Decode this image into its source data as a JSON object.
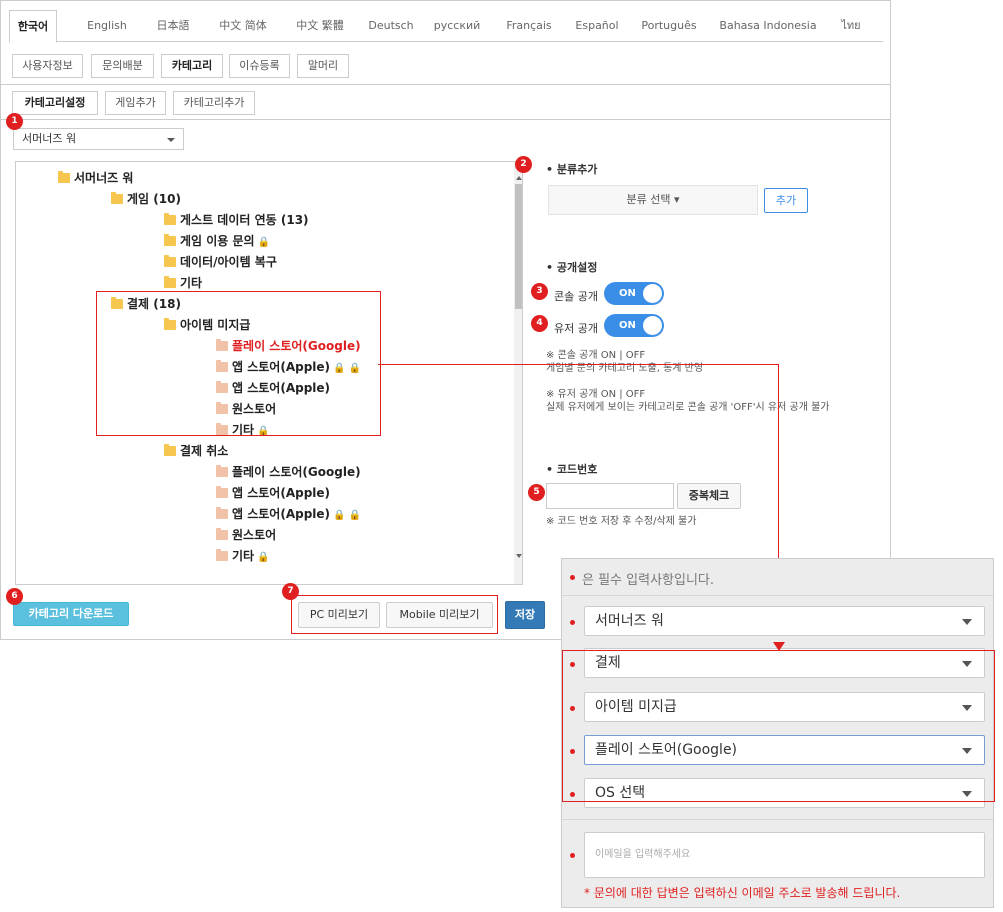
{
  "languages": [
    "한국어",
    "English",
    "日本語",
    "中文 简体",
    "中文 繁體",
    "Deutsch",
    "русский",
    "Français",
    "Español",
    "Português",
    "Bahasa Indonesia",
    "ไทย"
  ],
  "tabs": [
    "사용자정보",
    "문의배분",
    "카테고리",
    "이슈등록",
    "말머리"
  ],
  "subtabs": [
    "카테고리설정",
    "게임추가",
    "카테고리추가"
  ],
  "game_select": "서머너즈 워",
  "badges": [
    "1",
    "2",
    "3",
    "4",
    "5",
    "6",
    "7"
  ],
  "tree": [
    {
      "label": "서머너즈 워",
      "lock": ""
    },
    {
      "label": "게임 (10)",
      "lock": ""
    },
    {
      "label": "게스트 데이터 연동 (13)",
      "lock": ""
    },
    {
      "label": "게임 이용 문의",
      "lock": "🔒"
    },
    {
      "label": "데이터/아이템 복구",
      "lock": ""
    },
    {
      "label": "기타",
      "lock": ""
    },
    {
      "label": "결제 (18)",
      "lock": ""
    },
    {
      "label": "아이템 미지급",
      "lock": ""
    },
    {
      "label": "플레이 스토어(Google)",
      "lock": ""
    },
    {
      "label": "앱 스토어(Apple)",
      "lock": "🔒 🔒"
    },
    {
      "label": "앱 스토어(Apple)",
      "lock": ""
    },
    {
      "label": "원스토어",
      "lock": ""
    },
    {
      "label": "기타",
      "lock": "🔒"
    },
    {
      "label": "결제 취소",
      "lock": ""
    },
    {
      "label": "플레이 스토어(Google)",
      "lock": ""
    },
    {
      "label": "앱 스토어(Apple)",
      "lock": ""
    },
    {
      "label": "앱 스토어(Apple)",
      "lock": "🔒 🔒"
    },
    {
      "label": "원스토어",
      "lock": ""
    },
    {
      "label": "기타",
      "lock": "🔒"
    }
  ],
  "settings": {
    "add_class_label": "• 분류추가",
    "class_select": "분류 선택 ▾",
    "add_button": "추가",
    "public_label": "• 공개설정",
    "console_public": "콘솔 공개",
    "user_public": "유저 공개",
    "toggle_on": "ON",
    "note1_line1": "※ 콘솔 공개 ON | OFF",
    "note1_line2": "게임별 문의 카테고리 노출, 통계 반영",
    "note2_line1": "※ 유저 공개 ON | OFF",
    "note2_line2": "실제 유저에게 보이는 카테고리로 콘솔 공개 'OFF'시 유저 공개 불가",
    "code_label": "• 코드번호",
    "code_value": "",
    "dup_check": "중복체크",
    "code_note": "※ 코드 번호 저장 후 수정/삭제 불가"
  },
  "footer": {
    "download": "카테고리 다운로드",
    "pc_preview": "PC 미리보기",
    "mobile_preview": "Mobile 미리보기",
    "save": "저장"
  },
  "preview": {
    "required_note": "은 필수 입력사항입니다.",
    "selects": [
      "서머너즈 워",
      "결제",
      "아이템 미지급",
      "플레이 스토어(Google)",
      "OS 선택"
    ],
    "email_placeholder": "이메일을 입력해주세요",
    "reply_note": "* 문의에 대한 답변은 입력하신 이메일 주소로 발송해 드립니다."
  },
  "colors": {
    "accent": "#3b8ee8",
    "marker": "#e02020",
    "download": "#5bc0de",
    "save": "#337ab7"
  }
}
